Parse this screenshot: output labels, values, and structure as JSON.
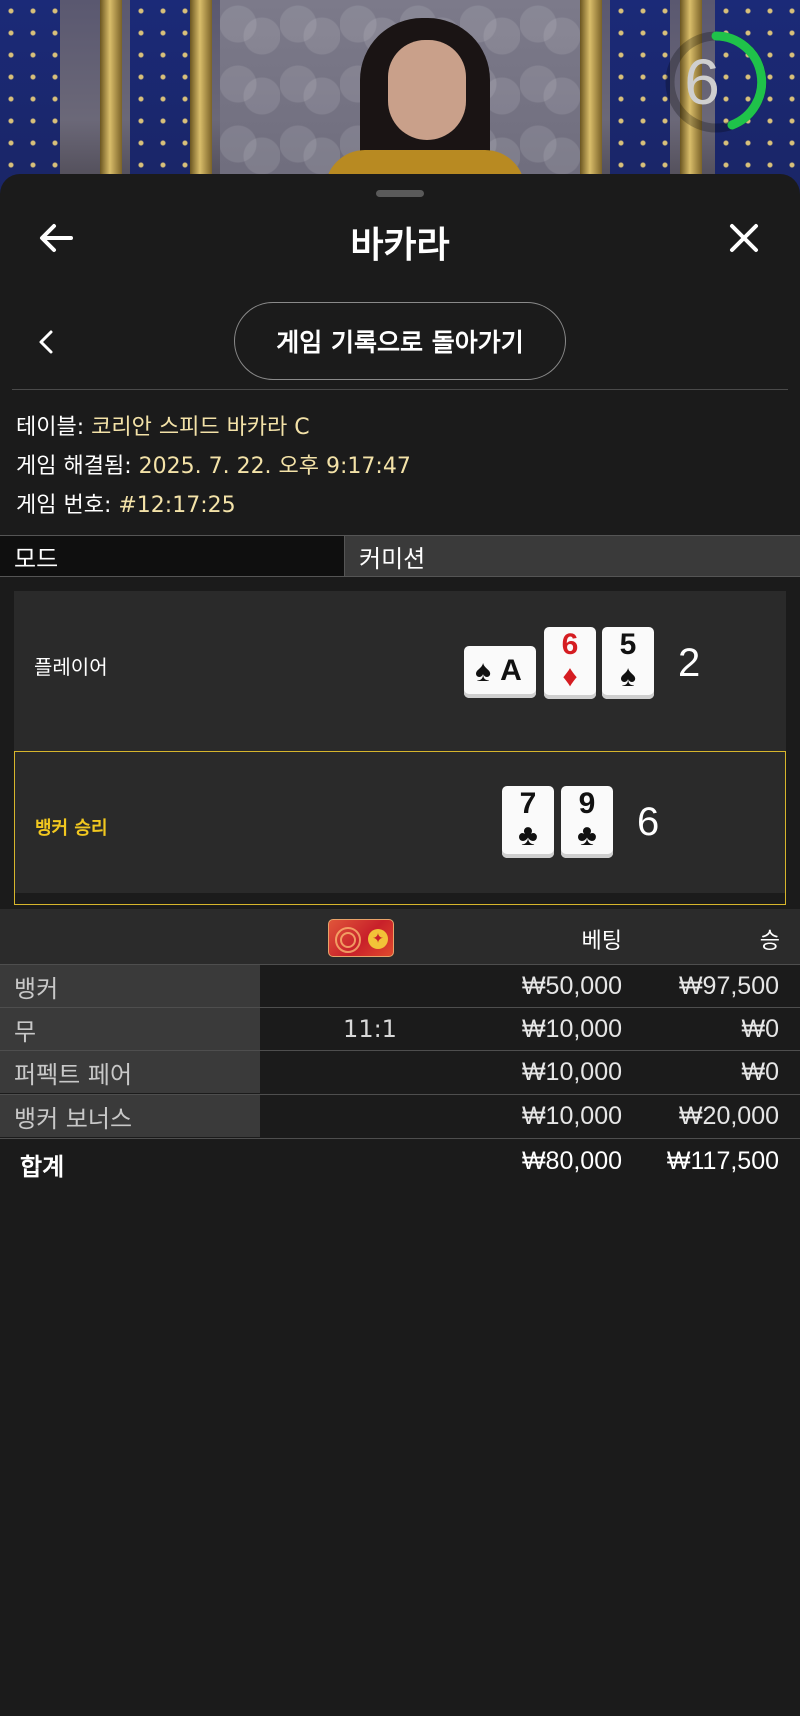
{
  "video": {
    "timer_value": "6",
    "timer_color": "#1fc24a"
  },
  "header": {
    "title": "바카라",
    "back_icon": "arrow-left-icon",
    "close_icon": "close-icon"
  },
  "nav": {
    "prev_icon": "chevron-left-icon",
    "history_button_label": "게임 기록으로 돌아가기"
  },
  "info": {
    "table_label": "테이블:",
    "table_value": "코리안 스피드 바카라 C",
    "resolved_label": "게임 해결됨:",
    "resolved_value": "2025. 7. 22. 오후 9:17:47",
    "number_label": "게임 번호:",
    "number_value": "#12:17:25"
  },
  "mode": {
    "label": "모드",
    "value": "커미션"
  },
  "result": {
    "player": {
      "label": "플레이어",
      "total": "2",
      "cards": [
        {
          "rank": "A",
          "suit": "♠",
          "color": "black",
          "orientation": "sideways"
        },
        {
          "rank": "6",
          "suit": "♦",
          "color": "red",
          "orientation": "upright"
        },
        {
          "rank": "5",
          "suit": "♠",
          "color": "black",
          "orientation": "upright"
        }
      ]
    },
    "banker": {
      "label": "뱅커 승리",
      "total": "6",
      "highlight_color": "#d6b52c",
      "cards": [
        {
          "rank": "7",
          "suit": "♣",
          "color": "black",
          "orientation": "upright"
        },
        {
          "rank": "9",
          "suit": "♣",
          "color": "black",
          "orientation": "upright"
        }
      ]
    }
  },
  "bets": {
    "badge_icon": "red-envelope-bonus-icon",
    "header_bet": "베팅",
    "header_win": "승",
    "rows": [
      {
        "name": "뱅커",
        "odds": "",
        "bet": "₩50,000",
        "win": "₩97,500"
      },
      {
        "name": "무",
        "odds": "11:1",
        "bet": "₩10,000",
        "win": "₩0"
      },
      {
        "name": "퍼펙트 페어",
        "odds": "",
        "bet": "₩10,000",
        "win": "₩0"
      },
      {
        "name": "뱅커 보너스",
        "odds": "",
        "bet": "₩10,000",
        "win": "₩20,000"
      }
    ],
    "total": {
      "name": "합계",
      "bet": "₩80,000",
      "win": "₩117,500"
    }
  }
}
